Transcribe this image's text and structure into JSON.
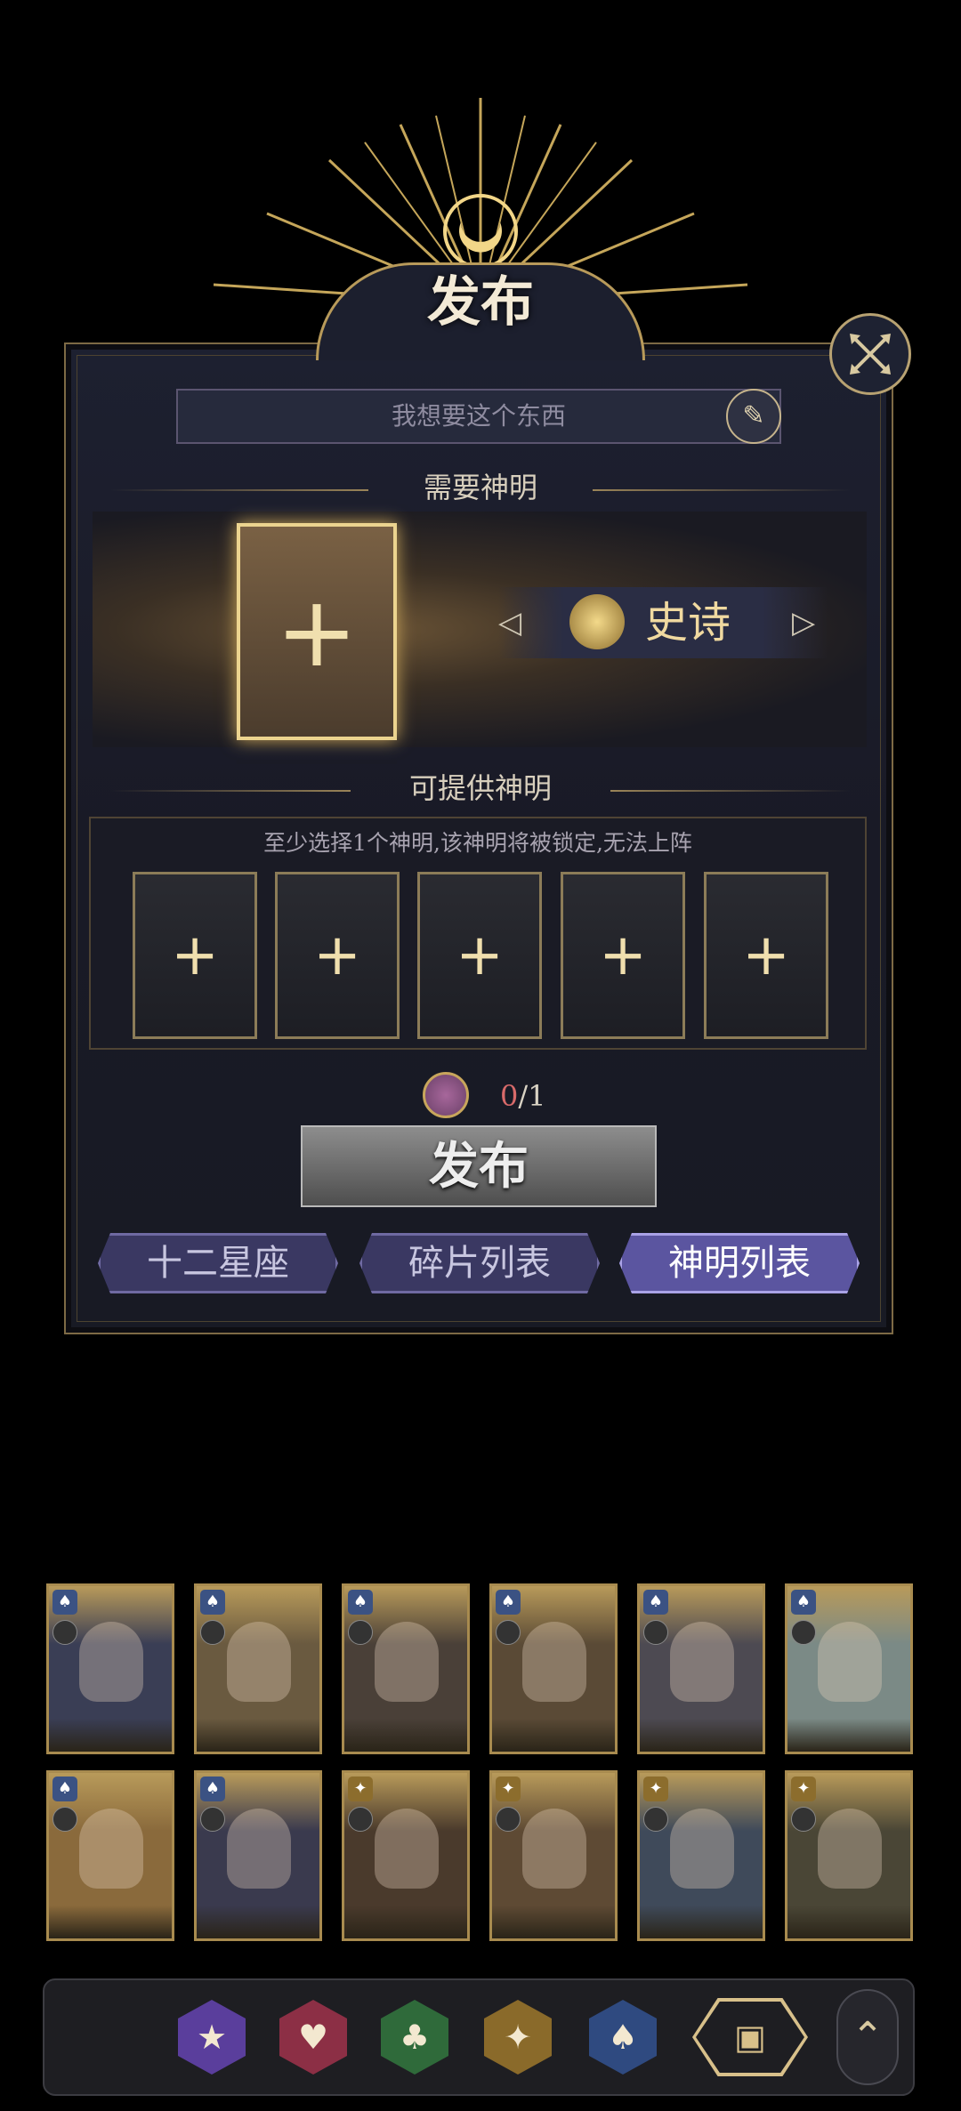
{
  "header": {
    "title": "发布"
  },
  "wish_input": {
    "placeholder": "我想要这个东西"
  },
  "required": {
    "heading": "需要神明",
    "rarity": "史诗"
  },
  "offer": {
    "heading": "可提供神明",
    "hint": "至少选择1个神明,该神明将被锁定,无法上阵",
    "slot_count": 5
  },
  "cost": {
    "current": "0",
    "total": "/1"
  },
  "publish_button": {
    "label": "发布"
  },
  "tabs": [
    {
      "label": "十二星座",
      "active": false
    },
    {
      "label": "碎片列表",
      "active": false
    },
    {
      "label": "神明列表",
      "active": true
    }
  ],
  "cards": [
    {
      "badge": "blue",
      "art": "#3a3e55"
    },
    {
      "badge": "blue",
      "art": "#6a5a40"
    },
    {
      "badge": "blue",
      "art": "#4a4038"
    },
    {
      "badge": "blue",
      "art": "#5a4a36"
    },
    {
      "badge": "blue",
      "art": "#4d4a52"
    },
    {
      "badge": "blue",
      "art": "#7b8a86"
    },
    {
      "badge": "blue",
      "art": "#8a6a3c"
    },
    {
      "badge": "blue",
      "art": "#3a3a4e"
    },
    {
      "badge": "gold",
      "art": "#4a3a2c"
    },
    {
      "badge": "gold",
      "art": "#5e4a34"
    },
    {
      "badge": "gold",
      "art": "#3f4a5a"
    },
    {
      "badge": "gold",
      "art": "#4a4636"
    }
  ],
  "dock": {
    "items": [
      {
        "icon": "star-suit-icon",
        "glyph": "★",
        "color": "#5a3e9c"
      },
      {
        "icon": "heart-suit-icon",
        "glyph": "♥",
        "color": "#8c2f45"
      },
      {
        "icon": "club-suit-icon",
        "glyph": "♣",
        "color": "#2f6a3a"
      },
      {
        "icon": "diamond-star-icon",
        "glyph": "✦",
        "color": "#8a6a2a"
      },
      {
        "icon": "spade-suit-icon",
        "glyph": "♠",
        "color": "#2f4a80"
      },
      {
        "icon": "grid-all-icon",
        "glyph": "▣",
        "color": "#2a2a30"
      }
    ]
  }
}
